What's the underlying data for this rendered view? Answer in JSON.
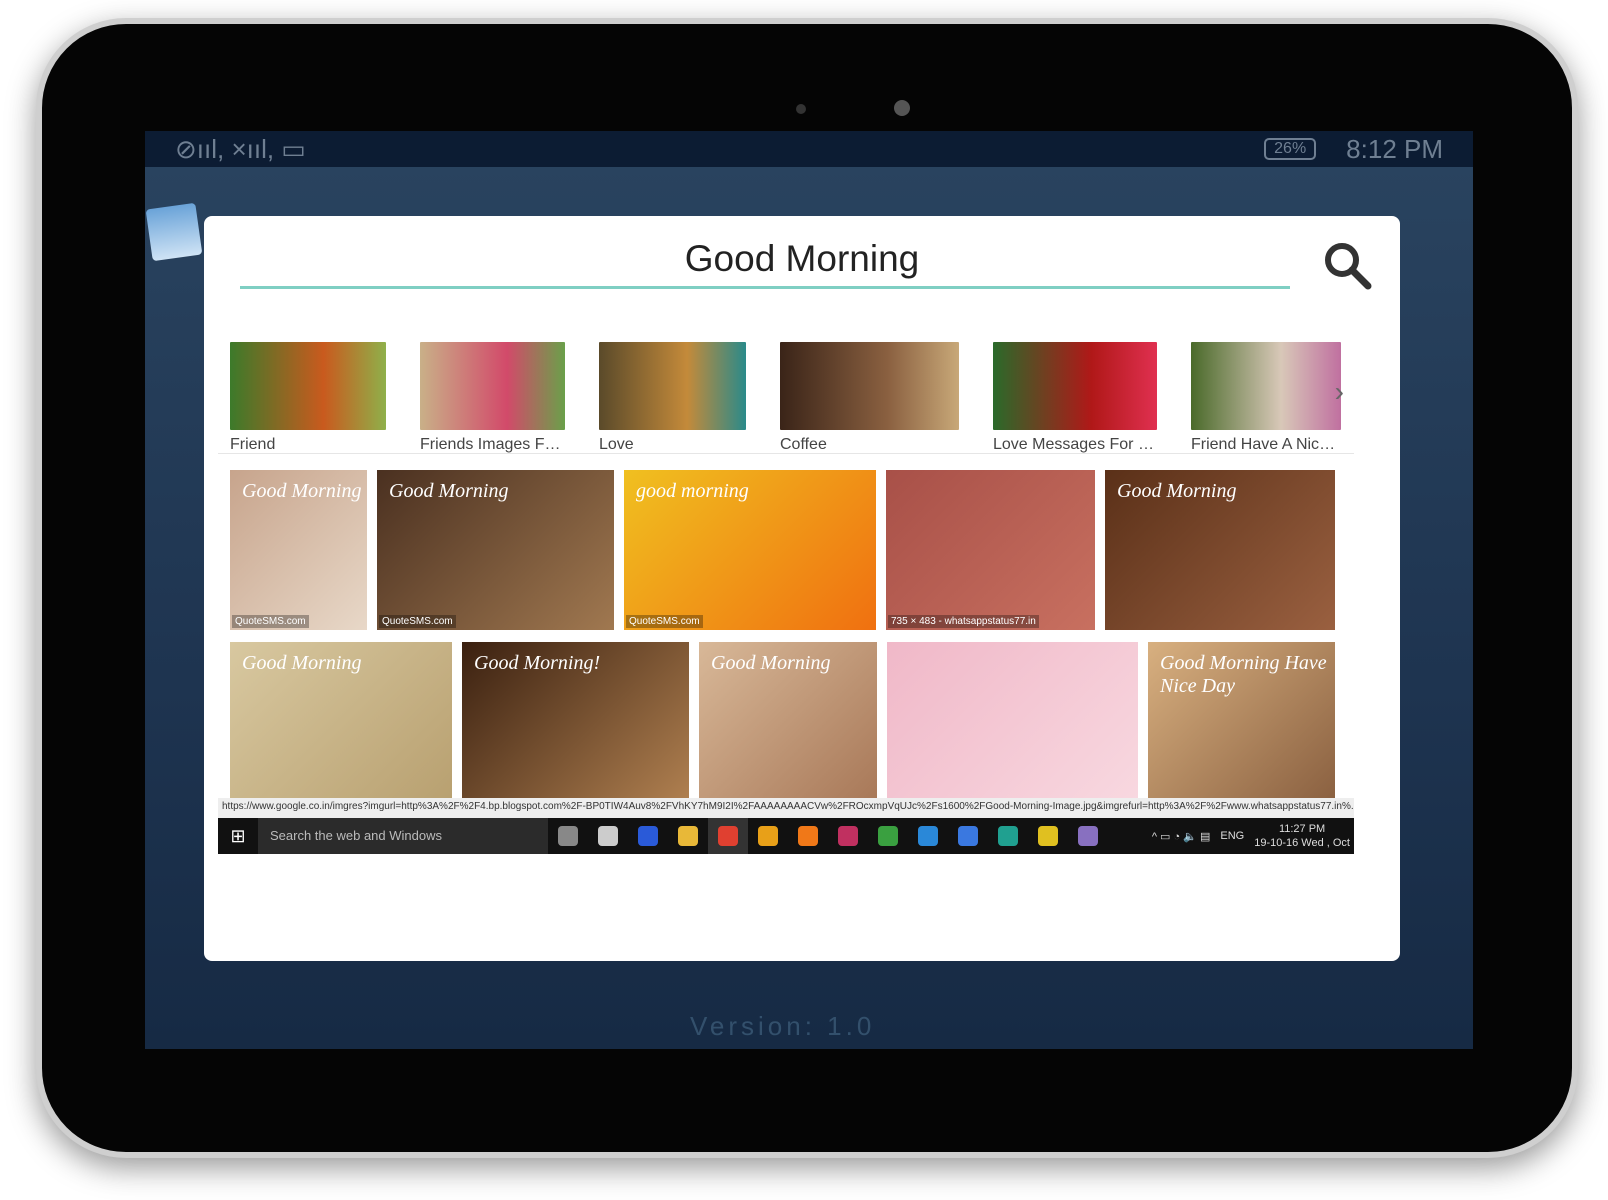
{
  "status": {
    "battery": "26%",
    "time": "8:12 PM"
  },
  "background": {
    "version": "Version: 1.0"
  },
  "dialog": {
    "title": "Good Morning"
  },
  "chips": [
    {
      "label": "Friend",
      "colors": [
        "#3c7a2a",
        "#c95a1e",
        "#8fb04a"
      ]
    },
    {
      "label": "Friends Images Fo...",
      "colors": [
        "#c9b088",
        "#d24a6a",
        "#6aa04a"
      ]
    },
    {
      "label": "Love",
      "colors": [
        "#5a4a2a",
        "#c48a3a",
        "#2a8a8a"
      ]
    },
    {
      "label": "Coffee",
      "colors": [
        "#3a2418",
        "#8a6040",
        "#c8a878"
      ]
    },
    {
      "label": "Love Messages For G...",
      "colors": [
        "#2a6a2a",
        "#b01818",
        "#e03050"
      ]
    },
    {
      "label": "Friend Have A Nice Da",
      "colors": [
        "#4a6a2a",
        "#d8c8b8",
        "#c070a0"
      ]
    }
  ],
  "images_row1": [
    {
      "caption": "Good Morning",
      "source": "QuoteSMS.com",
      "colors": [
        "#c7a48c",
        "#e8d8c8"
      ],
      "w": 137
    },
    {
      "caption": "Good Morning",
      "source": "QuoteSMS.com",
      "colors": [
        "#4a3020",
        "#a07850"
      ],
      "w": 237
    },
    {
      "caption": "good morning",
      "source": "QuoteSMS.com",
      "colors": [
        "#f0c020",
        "#f07010"
      ],
      "w": 252
    },
    {
      "caption": "",
      "source": "735 × 483 - whatsappstatus77.in",
      "colors": [
        "#a85048",
        "#c87060"
      ],
      "w": 209
    },
    {
      "caption": "Good Morning",
      "source": "",
      "colors": [
        "#5a3018",
        "#9a6040"
      ],
      "w": 230
    }
  ],
  "images_row2": [
    {
      "caption": "Good Morning",
      "source": "",
      "colors": [
        "#d8c8a0",
        "#b8a070"
      ],
      "w": 222
    },
    {
      "caption": "Good Morning!",
      "source": "",
      "colors": [
        "#3a2010",
        "#b08050"
      ],
      "w": 227
    },
    {
      "caption": "Good Morning",
      "source": "",
      "colors": [
        "#d8b898",
        "#a87858"
      ],
      "w": 178
    },
    {
      "caption": "",
      "source": "",
      "colors": [
        "#f0b8c8",
        "#f8d8e0"
      ],
      "w": 251
    },
    {
      "caption": "Good Morning  Have Nice Day",
      "source": "",
      "colors": [
        "#d8b080",
        "#8a6040"
      ],
      "w": 187
    }
  ],
  "url": "https://www.google.co.in/imgres?imgurl=http%3A%2F%2F4.bp.blogspot.com%2F-BP0TIW4Auv8%2FVhKY7hM9I2I%2FAAAAAAAACVw%2FROcxmpVqUJc%2Fs1600%2FGood-Morning-Image.jpg&imgrefurl=http%3A%2F%2Fwww.whatsappstatus77.in%...",
  "taskbar": {
    "search": "Search the web and Windows",
    "lang": "ENG",
    "time": "11:27 PM",
    "date": "19-10-16  Wed , Oct",
    "apps": [
      "#888",
      "#ccc",
      "#2a5ad8",
      "#e8b838",
      "#e04030",
      "#e8a018",
      "#f07818",
      "#c03060",
      "#3aa040",
      "#2a88d8",
      "#3a78e0",
      "#20a090",
      "#e0c020",
      "#8870c0"
    ]
  }
}
